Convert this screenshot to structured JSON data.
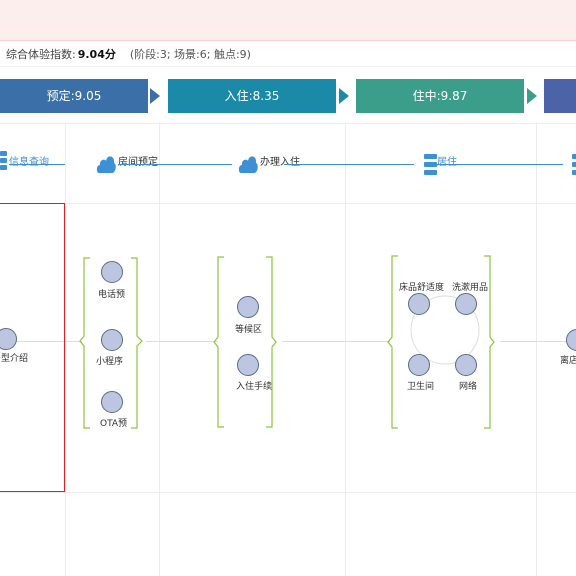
{
  "summary": {
    "label": "综合体验指数:",
    "score": "9.04分",
    "detail": "(阶段:3; 场景:6; 触点:9)"
  },
  "stages": [
    {
      "label": "预定:9.05",
      "color": "#3b6fa7"
    },
    {
      "label": "入住:8.35",
      "color": "#1a8aa8"
    },
    {
      "label": "住中:9.87",
      "color": "#3a9e8a"
    },
    {
      "label": "",
      "color": "#4d63a8"
    }
  ],
  "scenes": {
    "info_query": "信息查询",
    "room_booking": "房间预定",
    "check_in": "办理入住",
    "stay": "居住"
  },
  "touchpoints": {
    "room_type_intro": "房型介绍",
    "phone_booking": "电话预",
    "mini_program": "小程序",
    "ota_booking": "OTA预",
    "waiting_area": "等候区",
    "check_in_procedure": "入住手续",
    "bedding_comfort": "床品舒适度",
    "toiletries": "洗漱用品",
    "bathroom": "卫生间",
    "network": "网络",
    "checkout": "离店"
  },
  "colors": {
    "bracket": "#8cc63f",
    "node_fill": "#bcc6e0",
    "scene_link": "#3d8fd6",
    "selection": "#e02020"
  }
}
